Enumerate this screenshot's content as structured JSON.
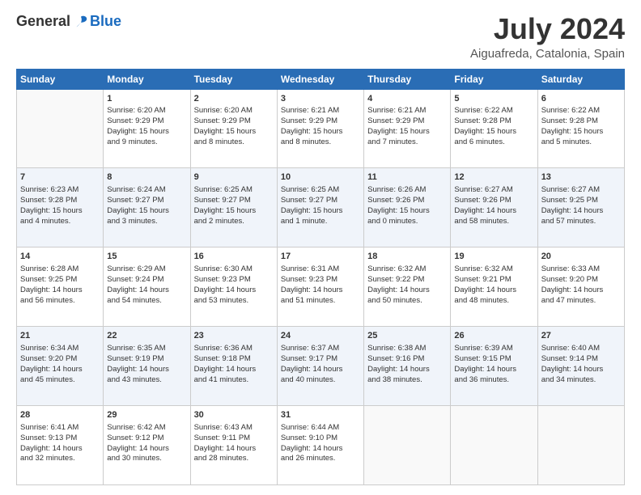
{
  "logo": {
    "general": "General",
    "blue": "Blue"
  },
  "header": {
    "month": "July 2024",
    "location": "Aiguafreda, Catalonia, Spain"
  },
  "days": [
    "Sunday",
    "Monday",
    "Tuesday",
    "Wednesday",
    "Thursday",
    "Friday",
    "Saturday"
  ],
  "weeks": [
    [
      {
        "day": "",
        "content": ""
      },
      {
        "day": "1",
        "content": "Sunrise: 6:20 AM\nSunset: 9:29 PM\nDaylight: 15 hours\nand 9 minutes."
      },
      {
        "day": "2",
        "content": "Sunrise: 6:20 AM\nSunset: 9:29 PM\nDaylight: 15 hours\nand 8 minutes."
      },
      {
        "day": "3",
        "content": "Sunrise: 6:21 AM\nSunset: 9:29 PM\nDaylight: 15 hours\nand 8 minutes."
      },
      {
        "day": "4",
        "content": "Sunrise: 6:21 AM\nSunset: 9:29 PM\nDaylight: 15 hours\nand 7 minutes."
      },
      {
        "day": "5",
        "content": "Sunrise: 6:22 AM\nSunset: 9:28 PM\nDaylight: 15 hours\nand 6 minutes."
      },
      {
        "day": "6",
        "content": "Sunrise: 6:22 AM\nSunset: 9:28 PM\nDaylight: 15 hours\nand 5 minutes."
      }
    ],
    [
      {
        "day": "7",
        "content": "Sunrise: 6:23 AM\nSunset: 9:28 PM\nDaylight: 15 hours\nand 4 minutes."
      },
      {
        "day": "8",
        "content": "Sunrise: 6:24 AM\nSunset: 9:27 PM\nDaylight: 15 hours\nand 3 minutes."
      },
      {
        "day": "9",
        "content": "Sunrise: 6:25 AM\nSunset: 9:27 PM\nDaylight: 15 hours\nand 2 minutes."
      },
      {
        "day": "10",
        "content": "Sunrise: 6:25 AM\nSunset: 9:27 PM\nDaylight: 15 hours\nand 1 minute."
      },
      {
        "day": "11",
        "content": "Sunrise: 6:26 AM\nSunset: 9:26 PM\nDaylight: 15 hours\nand 0 minutes."
      },
      {
        "day": "12",
        "content": "Sunrise: 6:27 AM\nSunset: 9:26 PM\nDaylight: 14 hours\nand 58 minutes."
      },
      {
        "day": "13",
        "content": "Sunrise: 6:27 AM\nSunset: 9:25 PM\nDaylight: 14 hours\nand 57 minutes."
      }
    ],
    [
      {
        "day": "14",
        "content": "Sunrise: 6:28 AM\nSunset: 9:25 PM\nDaylight: 14 hours\nand 56 minutes."
      },
      {
        "day": "15",
        "content": "Sunrise: 6:29 AM\nSunset: 9:24 PM\nDaylight: 14 hours\nand 54 minutes."
      },
      {
        "day": "16",
        "content": "Sunrise: 6:30 AM\nSunset: 9:23 PM\nDaylight: 14 hours\nand 53 minutes."
      },
      {
        "day": "17",
        "content": "Sunrise: 6:31 AM\nSunset: 9:23 PM\nDaylight: 14 hours\nand 51 minutes."
      },
      {
        "day": "18",
        "content": "Sunrise: 6:32 AM\nSunset: 9:22 PM\nDaylight: 14 hours\nand 50 minutes."
      },
      {
        "day": "19",
        "content": "Sunrise: 6:32 AM\nSunset: 9:21 PM\nDaylight: 14 hours\nand 48 minutes."
      },
      {
        "day": "20",
        "content": "Sunrise: 6:33 AM\nSunset: 9:20 PM\nDaylight: 14 hours\nand 47 minutes."
      }
    ],
    [
      {
        "day": "21",
        "content": "Sunrise: 6:34 AM\nSunset: 9:20 PM\nDaylight: 14 hours\nand 45 minutes."
      },
      {
        "day": "22",
        "content": "Sunrise: 6:35 AM\nSunset: 9:19 PM\nDaylight: 14 hours\nand 43 minutes."
      },
      {
        "day": "23",
        "content": "Sunrise: 6:36 AM\nSunset: 9:18 PM\nDaylight: 14 hours\nand 41 minutes."
      },
      {
        "day": "24",
        "content": "Sunrise: 6:37 AM\nSunset: 9:17 PM\nDaylight: 14 hours\nand 40 minutes."
      },
      {
        "day": "25",
        "content": "Sunrise: 6:38 AM\nSunset: 9:16 PM\nDaylight: 14 hours\nand 38 minutes."
      },
      {
        "day": "26",
        "content": "Sunrise: 6:39 AM\nSunset: 9:15 PM\nDaylight: 14 hours\nand 36 minutes."
      },
      {
        "day": "27",
        "content": "Sunrise: 6:40 AM\nSunset: 9:14 PM\nDaylight: 14 hours\nand 34 minutes."
      }
    ],
    [
      {
        "day": "28",
        "content": "Sunrise: 6:41 AM\nSunset: 9:13 PM\nDaylight: 14 hours\nand 32 minutes."
      },
      {
        "day": "29",
        "content": "Sunrise: 6:42 AM\nSunset: 9:12 PM\nDaylight: 14 hours\nand 30 minutes."
      },
      {
        "day": "30",
        "content": "Sunrise: 6:43 AM\nSunset: 9:11 PM\nDaylight: 14 hours\nand 28 minutes."
      },
      {
        "day": "31",
        "content": "Sunrise: 6:44 AM\nSunset: 9:10 PM\nDaylight: 14 hours\nand 26 minutes."
      },
      {
        "day": "",
        "content": ""
      },
      {
        "day": "",
        "content": ""
      },
      {
        "day": "",
        "content": ""
      }
    ]
  ]
}
